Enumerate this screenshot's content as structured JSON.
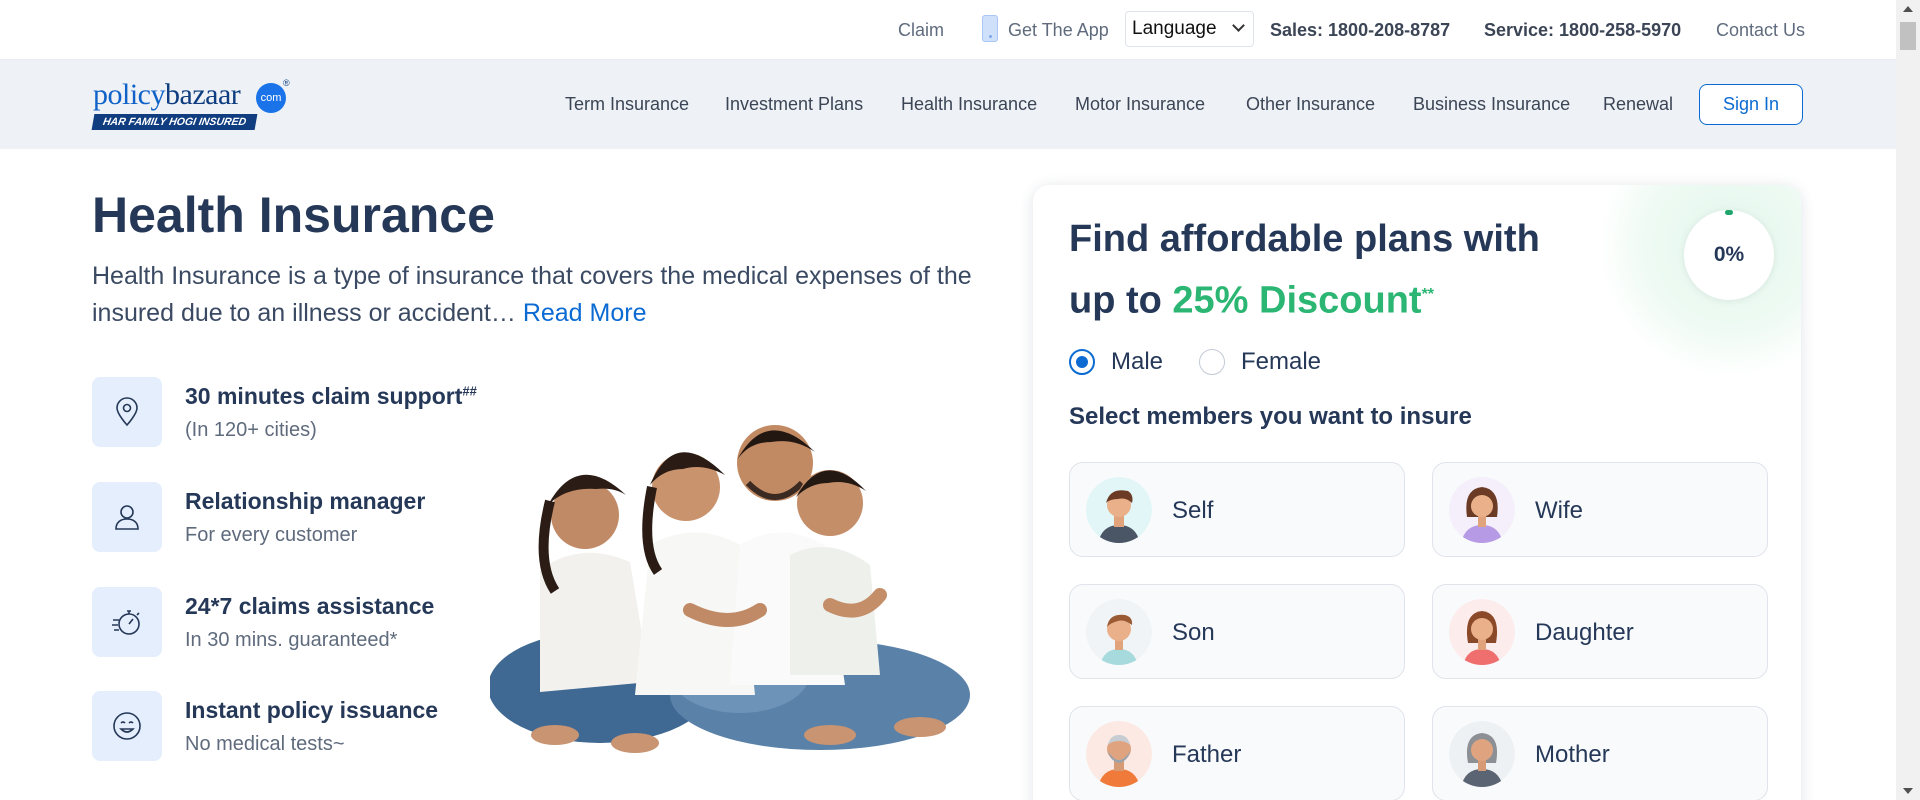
{
  "topbar": {
    "claim": "Claim",
    "get_app": "Get The App",
    "language": "Language",
    "sales": "Sales: 1800-208-8787",
    "service": "Service: 1800-258-5970",
    "contact": "Contact Us"
  },
  "logo": {
    "word_policy": "policy",
    "word_bazaar": "bazaar",
    "dotcom": "com",
    "reg": "®",
    "tagline": "HAR FAMILY HOGI INSURED"
  },
  "nav": {
    "items": [
      {
        "label": "Term Insurance"
      },
      {
        "label": "Investment Plans"
      },
      {
        "label": "Health Insurance"
      },
      {
        "label": "Motor Insurance"
      },
      {
        "label": "Other Insurance"
      },
      {
        "label": "Business Insurance"
      },
      {
        "label": "Renewal"
      }
    ],
    "signin": "Sign In"
  },
  "hero": {
    "title": "Health Insurance",
    "description": "Health Insurance is a type of insurance that covers the medical expenses of the insured due to an illness or accident…",
    "read_more": "Read More"
  },
  "features": [
    {
      "title": "30 minutes claim support",
      "sup": "##",
      "subtitle": "(In 120+ cities)",
      "icon": "location-pin-icon"
    },
    {
      "title": "Relationship manager",
      "sup": "",
      "subtitle": "For every customer",
      "icon": "user-icon"
    },
    {
      "title": "24*7 claims assistance",
      "sup": "",
      "subtitle": "In 30 mins. guaranteed*",
      "icon": "stopwatch-icon"
    },
    {
      "title": "Instant policy issuance",
      "sup": "",
      "subtitle": "No medical tests~",
      "icon": "smiley-icon"
    }
  ],
  "card": {
    "heading_prefix": "Find affordable plans with up to ",
    "discount": "25% Discount",
    "discount_sup": "**",
    "progress": "0%",
    "gender": {
      "male": "Male",
      "female": "Female",
      "selected": "Male"
    },
    "members_label": "Select members you want to insure",
    "members": [
      {
        "label": "Self",
        "avatar": "man-avatar-icon"
      },
      {
        "label": "Wife",
        "avatar": "woman-avatar-icon"
      },
      {
        "label": "Son",
        "avatar": "boy-avatar-icon"
      },
      {
        "label": "Daughter",
        "avatar": "girl-avatar-icon"
      },
      {
        "label": "Father",
        "avatar": "old-man-avatar-icon"
      },
      {
        "label": "Mother",
        "avatar": "old-woman-avatar-icon"
      }
    ]
  },
  "colors": {
    "brand_blue": "#0b6bd3",
    "navy": "#253858",
    "discount_green": "#2bb673",
    "nav_bg": "#eef2f6"
  }
}
